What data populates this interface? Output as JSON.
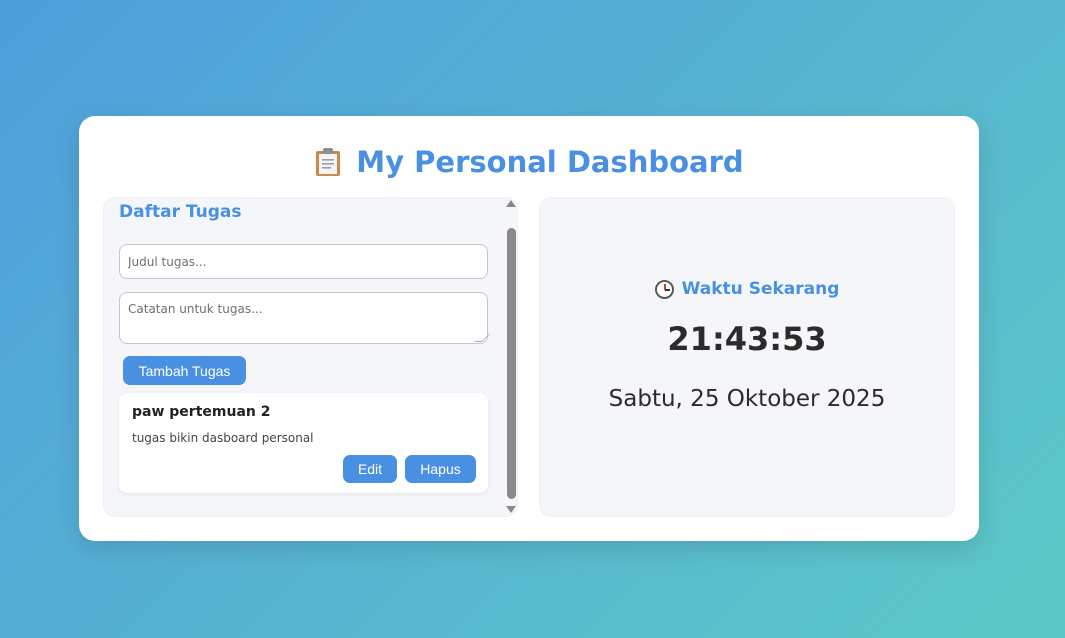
{
  "header": {
    "title": "My Personal Dashboard",
    "icon": "clipboard-icon",
    "accent_color": "#4a90e2"
  },
  "tasks_panel": {
    "heading": "Daftar Tugas",
    "title_placeholder": "Judul tugas...",
    "notes_placeholder": "Catatan untuk tugas...",
    "add_button_label": "Tambah Tugas",
    "tasks": [
      {
        "name": "paw pertemuan 2",
        "description": "tugas bikin dasboard personal",
        "edit_label": "Edit",
        "delete_label": "Hapus"
      }
    ]
  },
  "clock_panel": {
    "heading": "Waktu Sekarang",
    "icon": "clock-icon",
    "time": "21:43:53",
    "date": "Sabtu, 25 Oktober 2025"
  }
}
